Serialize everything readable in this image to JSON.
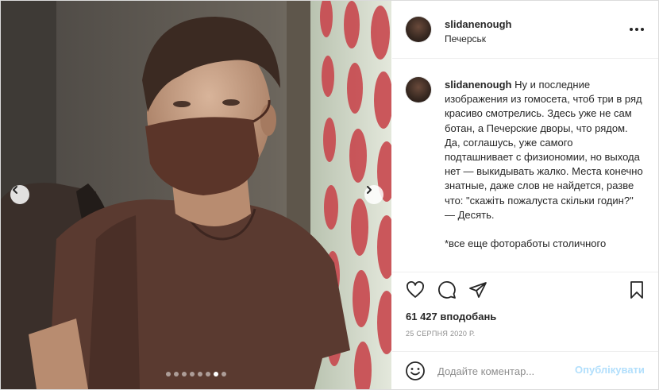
{
  "post": {
    "username": "slidanenough",
    "location": "Печерськ",
    "caption": "Ну и последние изображения из гомосета, чтоб три в ряд красиво смотрелись. Здесь уже не сам ботан, а Печерские дворы, что рядом. Да, соглашусь, уже самого подташнивает с физиономии, но выхода нет — выкидывать жалко. Места конечно знатные, даже слов не найдется, разве что: \"скажіть пожалуста скільки годин?\"\n— Десять.\n\n*все еще фотоработы столичного",
    "likes": "61 427 вподобань",
    "date": "25 серпня 2020 р."
  },
  "comment": {
    "placeholder": "Додайте коментар...",
    "publish_label": "Опублікувати"
  },
  "carousel": {
    "total": 8,
    "active_index": 6
  },
  "icons": {
    "prev": "chevron-left-icon",
    "next": "chevron-right-icon",
    "more": "more-dots-icon",
    "like": "heart-icon",
    "comment": "comment-bubble-icon",
    "share": "paper-plane-icon",
    "save": "bookmark-icon",
    "emoji": "smiley-icon"
  },
  "colors": {
    "publish_disabled": "#b2dffc",
    "secondary_text": "#8e8e8e",
    "wall_hearts": "#c8484e"
  }
}
